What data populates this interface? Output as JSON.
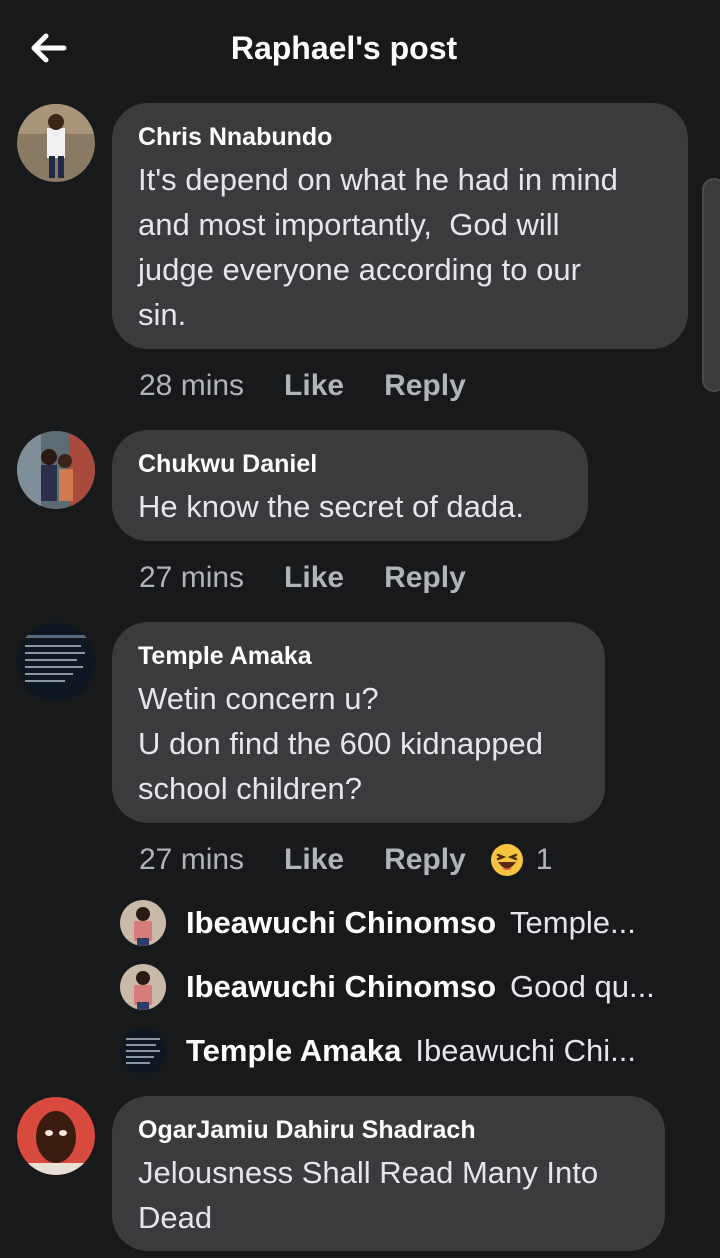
{
  "header": {
    "title": "Raphael's post",
    "back_icon": "arrow-left-icon"
  },
  "comments": [
    {
      "author": "Chris Nnabundo",
      "text": "It's depend on what he had in mind\nand most importantly,  God will\njudge everyone according to our\nsin.",
      "time": "28 mins",
      "like": "Like",
      "reply": "Reply"
    },
    {
      "author": "Chukwu Daniel",
      "text": "He know the secret of dada.",
      "time": "27 mins",
      "like": "Like",
      "reply": "Reply"
    },
    {
      "author": "Temple Amaka",
      "text": "Wetin concern u?\nU don find the 600 kidnapped\nschool children?",
      "time": "27 mins",
      "like": "Like",
      "reply": "Reply",
      "reaction": {
        "icon": "laughing-emoji-icon",
        "count": "1"
      },
      "replies": [
        {
          "name": "Ibeawuchi Chinomso",
          "text": "Temple..."
        },
        {
          "name": "Ibeawuchi Chinomso",
          "text": "Good qu..."
        },
        {
          "name": "Temple Amaka",
          "text": "Ibeawuchi Chi..."
        }
      ]
    },
    {
      "author": "OgarJamiu Dahiru Shadrach",
      "text": "Jelousness Shall Read Many Into\nDead"
    }
  ],
  "colors": {
    "background": "#18191a",
    "bubble": "#3a3b3c",
    "meta": "#b0b3b8"
  }
}
